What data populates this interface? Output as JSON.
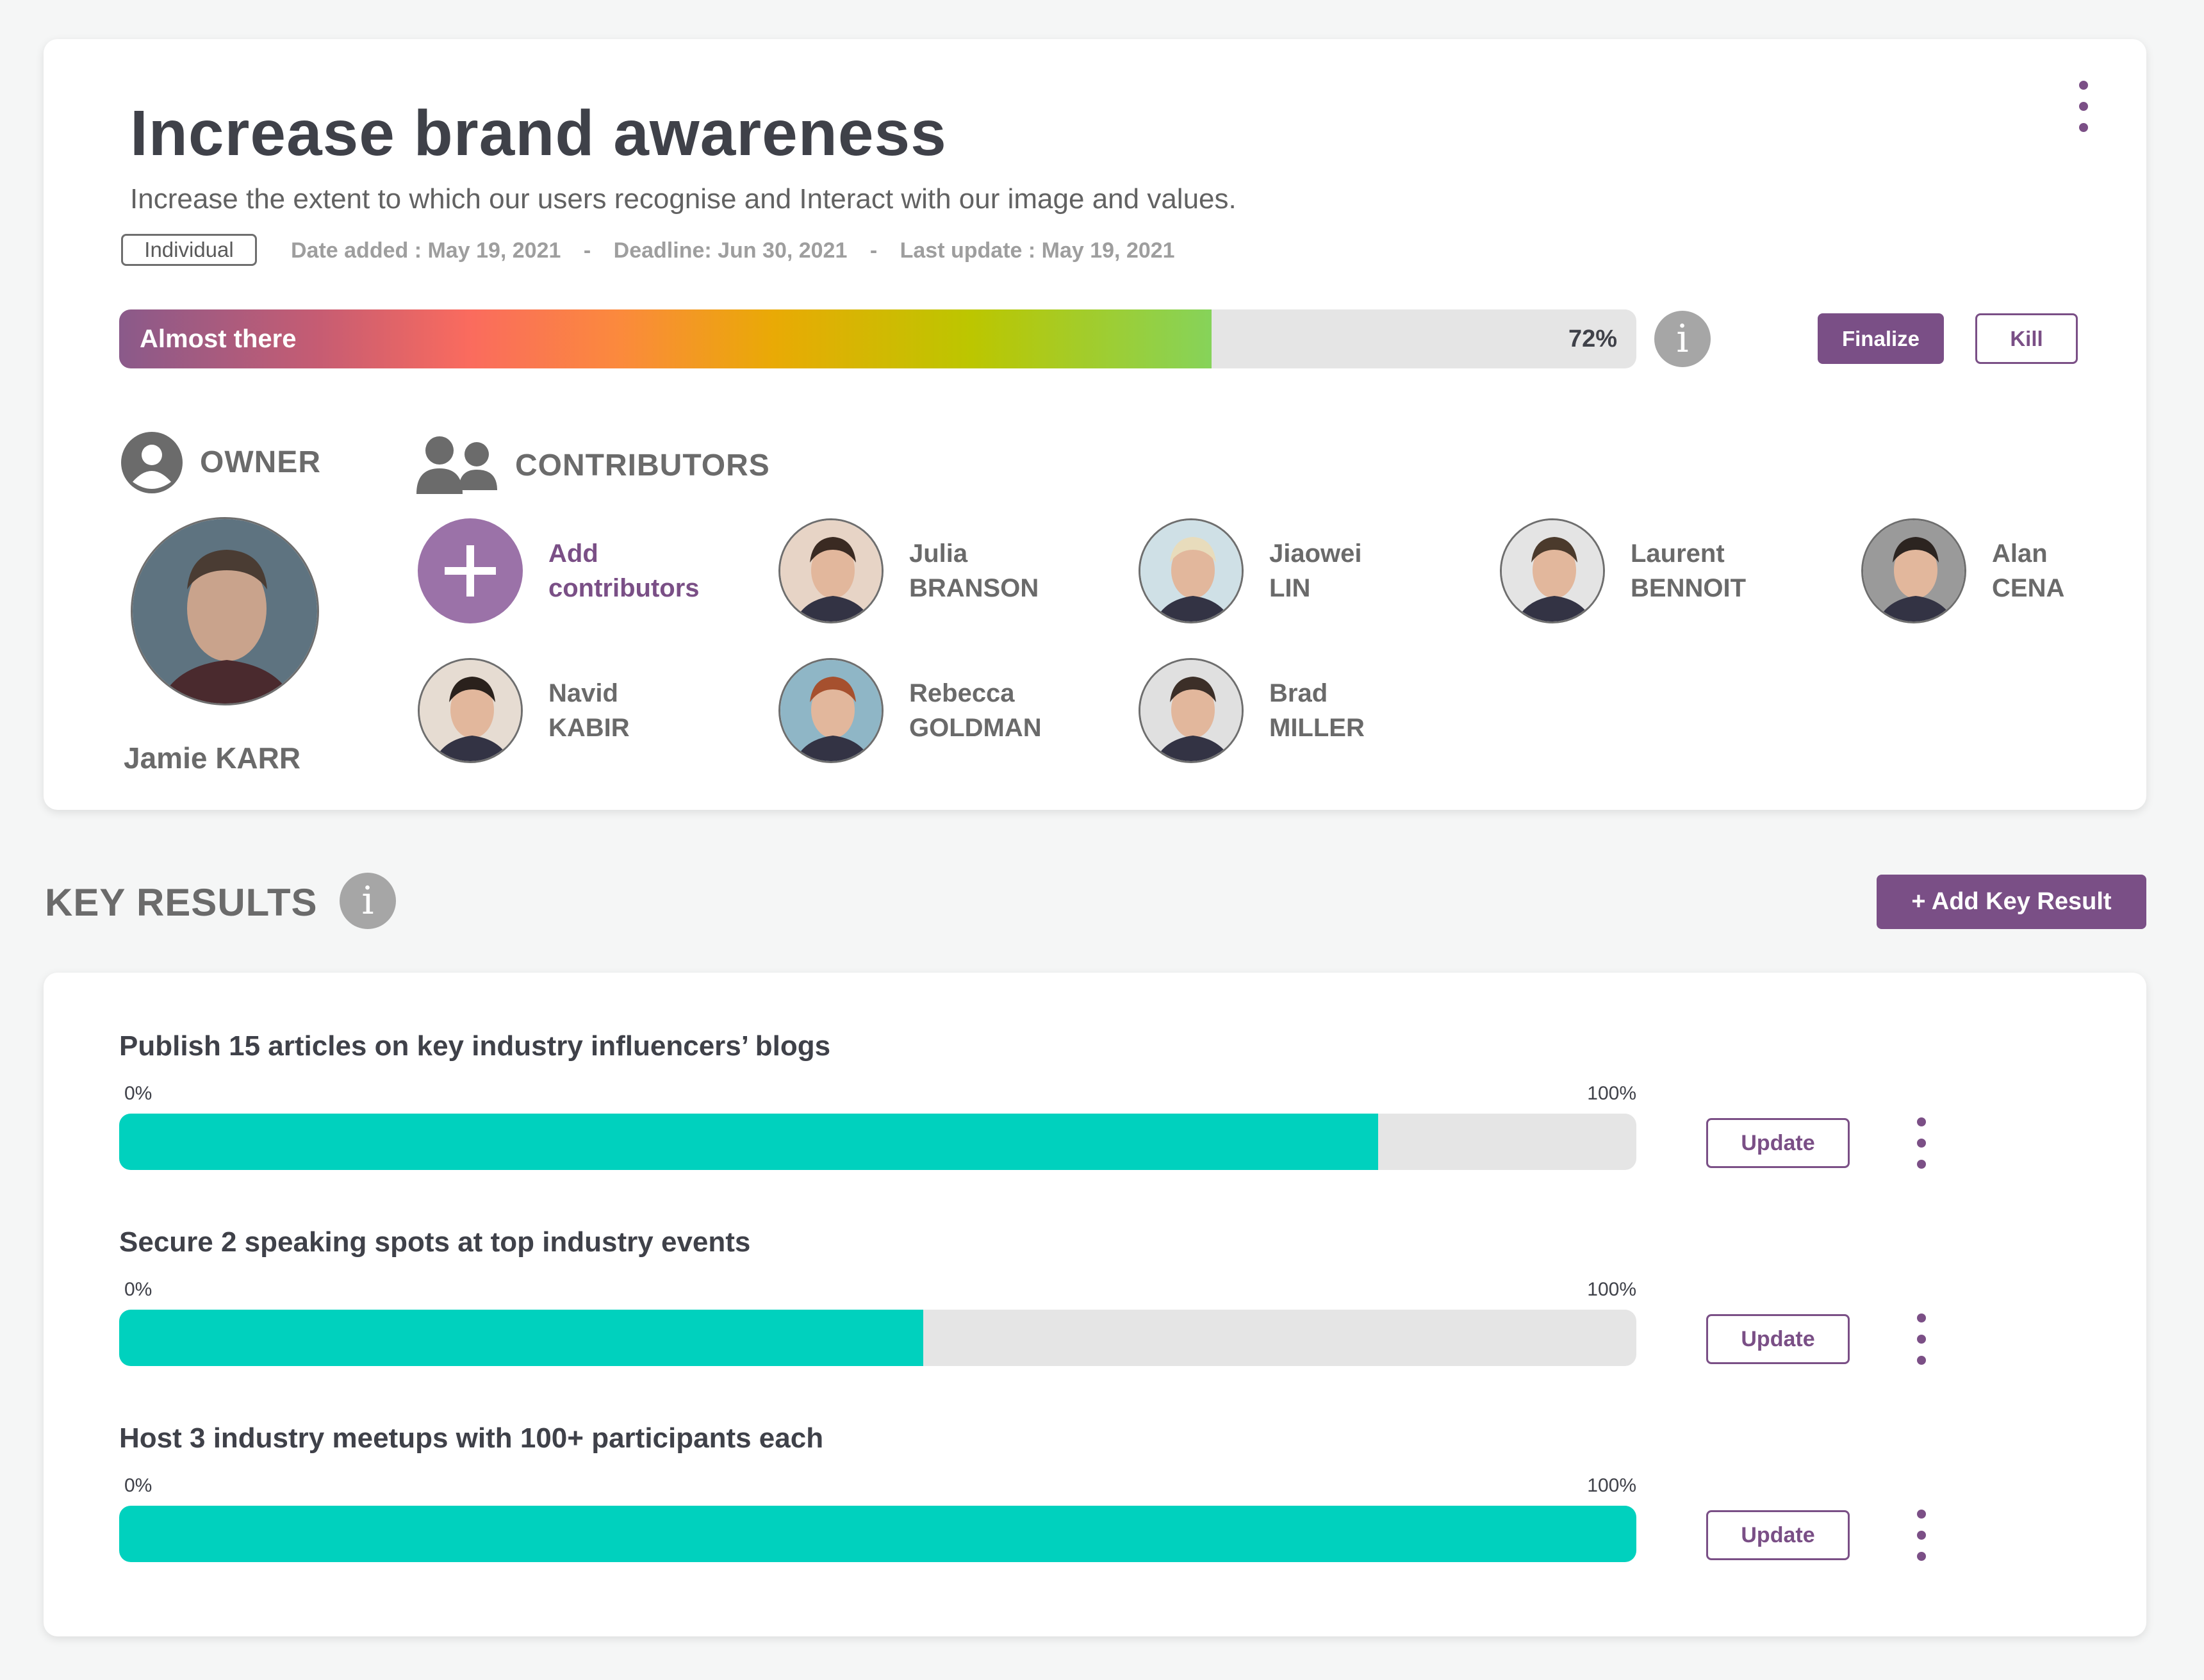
{
  "objective": {
    "title": "Increase brand awareness",
    "description": "Increase the extent to which our users recognise and Interact with our image and values.",
    "type_badge": "Individual",
    "date_added": "Date added : May 19, 2021",
    "deadline": "Deadline: Jun 30, 2021",
    "last_update": "Last update : May 19, 2021",
    "separator": "-",
    "progress": {
      "label": "Almost there",
      "percent_text": "72%",
      "percent": 72
    },
    "actions": {
      "finalize": "Finalize",
      "kill": "Kill"
    },
    "owner": {
      "heading": "OWNER",
      "name": "Jamie KARR"
    },
    "contributors": {
      "heading": "CONTRIBUTORS",
      "add_label_line1": "Add",
      "add_label_line2": "contributors",
      "people": [
        {
          "first": "Julia",
          "last": "BRANSON"
        },
        {
          "first": "Jiaowei",
          "last": "LIN"
        },
        {
          "first": "Laurent",
          "last": "BENNOIT"
        },
        {
          "first": "Alan",
          "last": "CENA"
        },
        {
          "first": "Navid",
          "last": "KABIR"
        },
        {
          "first": "Rebecca",
          "last": "GOLDMAN"
        },
        {
          "first": "Brad",
          "last": "MILLER"
        }
      ]
    }
  },
  "key_results": {
    "heading": "KEY RESULTS",
    "add_button": "+ Add Key Result",
    "items": [
      {
        "title": "Publish 15 articles on key industry influencers’ blogs",
        "min": "0%",
        "max": "100%",
        "progress": 83,
        "update": "Update"
      },
      {
        "title": "Secure 2 speaking spots at top industry events",
        "min": "0%",
        "max": "100%",
        "progress": 53,
        "update": "Update"
      },
      {
        "title": "Host 3 industry meetups with 100+ participants each",
        "min": "0%",
        "max": "100%",
        "progress": 100,
        "update": "Update"
      }
    ]
  },
  "colors": {
    "brand": "#7a4f86",
    "kr_fill": "#00d1be",
    "track": "#e5e5e5"
  },
  "icons": {
    "info": "i",
    "plus": "+"
  }
}
